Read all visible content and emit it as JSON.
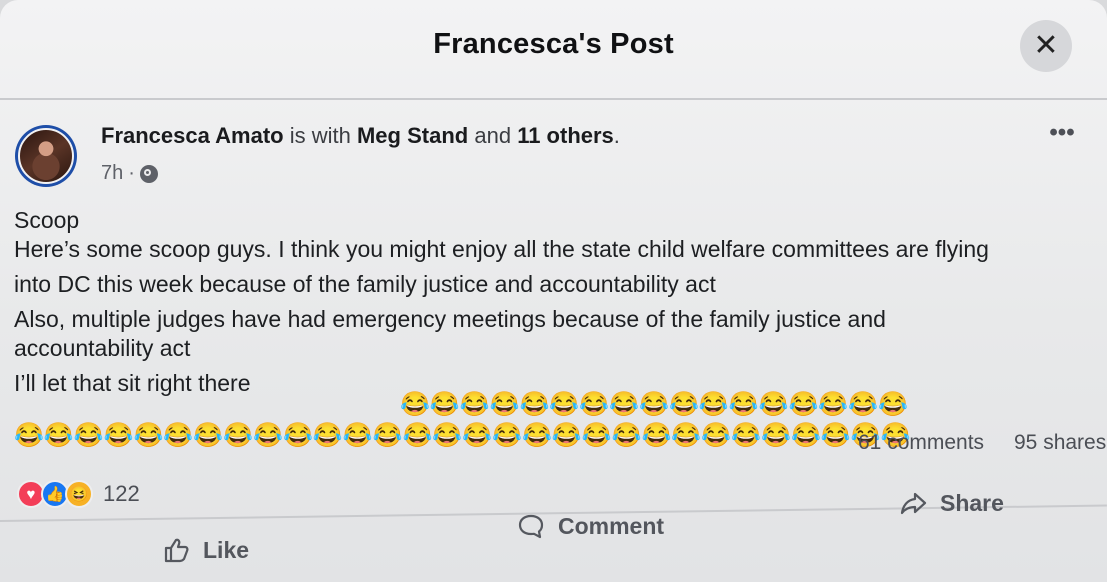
{
  "modal": {
    "title": "Francesca's Post",
    "close_icon": "close-icon"
  },
  "post": {
    "author": {
      "name": "Francesca Amato",
      "with_text": "is with",
      "tagged": "Meg Stand",
      "and_text": "and",
      "others": "11 others",
      "period": "."
    },
    "meta": {
      "time": "7h",
      "separator": "·",
      "privacy_icon": "globe-icon"
    },
    "more_icon": "more-options-icon",
    "body": {
      "line_1": "Scoop",
      "line_2": "Here’s some scoop guys. I think you might enjoy all the state child welfare committees are flying",
      "line_3": "into DC this week because of the family justice and accountability act",
      "line_4": "Also, multiple judges have had emergency meetings because of the family justice and",
      "line_5": "accountability act",
      "line_6": "I’ll let that sit right there",
      "emoji_top": "😂😂😂😂😂😂😂😂😂😂😂😂😂😂😂😂😂",
      "emoji_bottom": "😂😂😂😂😂😂😂😂😂😂😂😂😂😂😂😂😂😂😂😂😂😂😂😂😂😂😂😂😂😂"
    },
    "stats": {
      "comments": "61 comments",
      "shares": "95 shares",
      "reactions_count": "122"
    },
    "reactions": [
      {
        "name": "love",
        "icon": "heart-icon",
        "symbol": "♥",
        "color": "#f33e58"
      },
      {
        "name": "like",
        "icon": "thumbs-up-icon",
        "symbol": "👍",
        "color": "#1877f2"
      },
      {
        "name": "haha",
        "icon": "laugh-icon",
        "symbol": "😆",
        "color": "#f7b125"
      }
    ],
    "actions": {
      "like": "Like",
      "comment": "Comment",
      "share": "Share"
    }
  }
}
